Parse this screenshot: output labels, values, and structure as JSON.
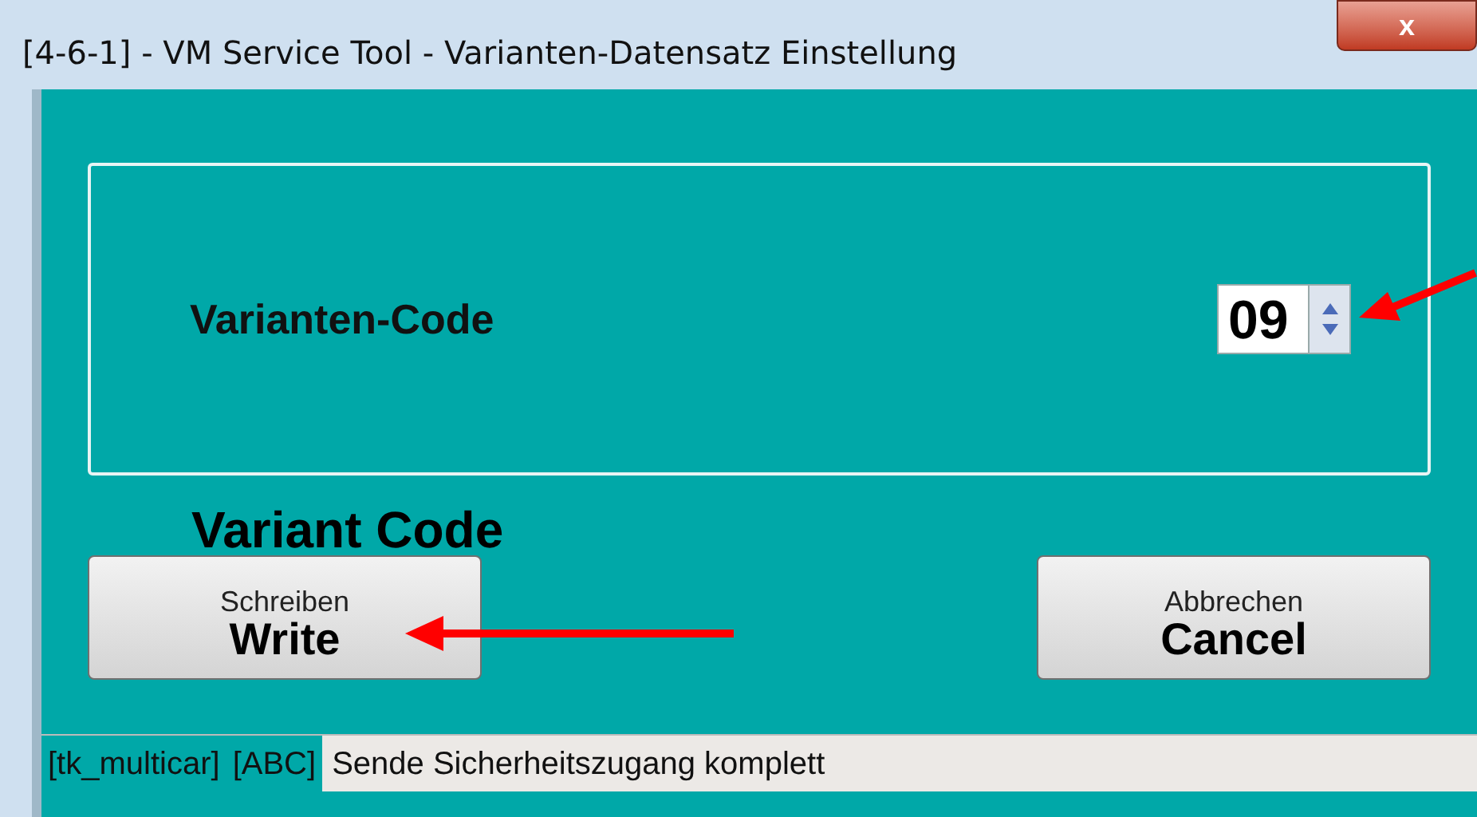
{
  "window": {
    "title": "[4-6-1] - VM Service Tool - Varianten-Datensatz Einstellung",
    "close": "x"
  },
  "panel": {
    "label": "Varianten-Code",
    "spinner": {
      "value": "09"
    }
  },
  "annotations": {
    "code": "Variant Code"
  },
  "buttons": [
    {
      "label": "Schreiben",
      "annotation": "Write"
    },
    {
      "label": "Abbrechen",
      "annotation": "Cancel"
    }
  ],
  "status_bar": {
    "segments": [
      {
        "text": "[tk_multicar]",
        "highlighted": true
      },
      {
        "text": "[ABC]",
        "highlighted": true
      },
      {
        "text": "Sende Sicherheitszugang komplett",
        "highlighted": false
      }
    ]
  }
}
